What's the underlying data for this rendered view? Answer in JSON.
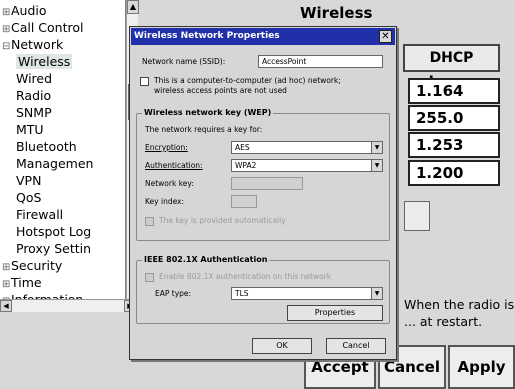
{
  "page": {
    "title": "Wireless"
  },
  "tree": {
    "items": [
      {
        "label": "Audio",
        "expander": "⊞"
      },
      {
        "label": "Call Control",
        "expander": "⊞"
      },
      {
        "label": "Network",
        "expander": "⊟"
      },
      {
        "label": "Wireless",
        "expander": ""
      },
      {
        "label": "Wired",
        "expander": ""
      },
      {
        "label": "Radio",
        "expander": ""
      },
      {
        "label": "SNMP",
        "expander": ""
      },
      {
        "label": "MTU",
        "expander": ""
      },
      {
        "label": "Bluetooth",
        "expander": ""
      },
      {
        "label": "Managemen",
        "expander": ""
      },
      {
        "label": "VPN",
        "expander": ""
      },
      {
        "label": "QoS",
        "expander": ""
      },
      {
        "label": "Firewall",
        "expander": ""
      },
      {
        "label": "Hotspot Log",
        "expander": ""
      },
      {
        "label": "Proxy Settin",
        "expander": ""
      },
      {
        "label": "Security",
        "expander": "⊞"
      },
      {
        "label": "Time",
        "expander": "⊞"
      },
      {
        "label": "Information",
        "expander": "⊞"
      }
    ],
    "selected": "Wireless"
  },
  "background": {
    "dhcp_button": "DHCP Lease",
    "fields": [
      "1.164",
      "255.0",
      "1.253",
      "1.200"
    ],
    "note": "When the radio is ... at restart.",
    "buttons": {
      "accept": "Accept",
      "cancel": "Cancel",
      "apply": "Apply"
    }
  },
  "dialog": {
    "title": "Wireless Network Properties",
    "network_name_label": "Network name (SSID):",
    "network_name_value": "AccessPoint",
    "adhoc_text_line1": "This is a computer-to-computer (ad hoc) network;",
    "adhoc_text_line2": "wireless access points are not used",
    "wep_group": {
      "title": "Wireless network key (WEP)",
      "requires_label": "The network requires a key for:",
      "encryption_label": "Encryption:",
      "encryption_value": "AES",
      "authentication_label": "Authentication:",
      "authentication_value": "WPA2",
      "network_key_label": "Network key:",
      "key_index_label": "Key index:",
      "auto_key_label": "The key is provided automatically"
    },
    "ieee_group": {
      "title": "IEEE 802.1X Authentication",
      "enable_label": "Enable 802.1X authentication on this network",
      "eap_label": "EAP type:",
      "eap_value": "TLS",
      "properties_button": "Properties"
    },
    "ok_button": "OK",
    "cancel_button": "Cancel"
  },
  "icons": {
    "expand": "plus-box-icon",
    "collapse": "minus-box-icon",
    "dropdown": "triangle-down-icon",
    "close": "close-icon"
  }
}
